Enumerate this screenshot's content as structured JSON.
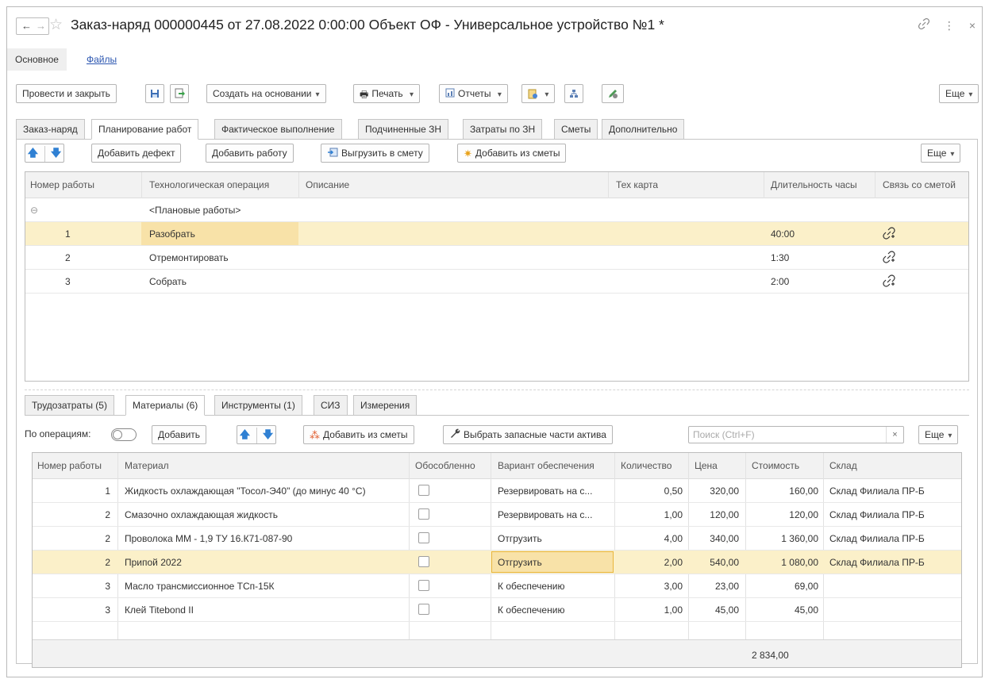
{
  "window": {
    "title": "Заказ-наряд 000000445 от 27.08.2022 0:00:00 Объект ОФ - Универсальное устройство №1 *",
    "nav_back": "←",
    "nav_forward": "→",
    "star": "☆",
    "icons": [
      "link-icon",
      "more-icon",
      "close-icon"
    ]
  },
  "section_tabs": {
    "main": "Основное",
    "files": "Файлы"
  },
  "toolbar": {
    "post_close": "Провести и закрыть",
    "create_based": "Создать на основании",
    "print": "Печать",
    "reports": "Отчеты",
    "more": "Еще"
  },
  "tabs": [
    "Заказ-наряд",
    "Планирование работ",
    "Фактическое выполнение",
    "Подчиненные ЗН",
    "Затраты по ЗН",
    "Сметы",
    "Дополнительно"
  ],
  "works_toolbar": {
    "add_defect": "Добавить дефект",
    "add_work": "Добавить работу",
    "export_estimate": "Выгрузить в смету",
    "add_from_estimate": "Добавить из сметы",
    "more": "Еще"
  },
  "works_table": {
    "columns": [
      "Номер работы",
      "Технологическая операция",
      "Описание",
      "Тех карта",
      "Длительность часы",
      "Связь со сметой"
    ],
    "group_label": "<Плановые работы>",
    "group_toggle": "⊖",
    "rows": [
      {
        "num": "1",
        "operation": "Разобрать",
        "duration": "40:00",
        "link_icon": "chain-link-icon"
      },
      {
        "num": "2",
        "operation": "Отремонтировать",
        "duration": "1:30",
        "link_icon": "chain-link-icon"
      },
      {
        "num": "3",
        "operation": "Собрать",
        "duration": "2:00",
        "link_icon": "chain-link-icon"
      }
    ],
    "selected_row": 0
  },
  "sub_tabs": [
    "Трудозатраты (5)",
    "Материалы (6)",
    "Инструменты (1)",
    "СИЗ",
    "Измерения"
  ],
  "materials_toolbar": {
    "by_operations": "По операциям:",
    "add": "Добавить",
    "add_from_estimate": "Добавить из сметы",
    "choose_parts": "Выбрать запасные части актива",
    "search_placeholder": "Поиск (Ctrl+F)",
    "clear": "×",
    "more": "Еще"
  },
  "materials_table": {
    "columns": [
      "Номер работы",
      "Материал",
      "Обособленно",
      "Вариант обеспечения",
      "Количество",
      "Цена",
      "Стоимость",
      "Склад"
    ],
    "rows": [
      {
        "num": "1",
        "material": "Жидкость охлаждающая \"Тосол-Э40\" (до минус 40 °C)",
        "variant": "Резервировать на с...",
        "qty": "0,50",
        "price": "320,00",
        "cost": "160,00",
        "warehouse": "Склад Филиала ПР-Б"
      },
      {
        "num": "2",
        "material": "Смазочно охлаждающая жидкость",
        "variant": "Резервировать на с...",
        "qty": "1,00",
        "price": "120,00",
        "cost": "120,00",
        "warehouse": "Склад Филиала ПР-Б"
      },
      {
        "num": "2",
        "material": "Проволока  ММ - 1,9 ТУ 16.К71-087-90",
        "variant": "Отгрузить",
        "qty": "4,00",
        "price": "340,00",
        "cost": "1 360,00",
        "warehouse": "Склад Филиала ПР-Б"
      },
      {
        "num": "2",
        "material": "Припой 2022",
        "variant": "Отгрузить",
        "qty": "2,00",
        "price": "540,00",
        "cost": "1 080,00",
        "warehouse": "Склад Филиала ПР-Б"
      },
      {
        "num": "3",
        "material": "Масло трансмиссионное ТСп-15К",
        "variant": "К обеспечению",
        "qty": "3,00",
        "price": "23,00",
        "cost": "69,00",
        "warehouse": ""
      },
      {
        "num": "3",
        "material": "Клей Titebond II",
        "variant": "К обеспечению",
        "qty": "1,00",
        "price": "45,00",
        "cost": "45,00",
        "warehouse": ""
      }
    ],
    "selected_row": 3,
    "total_cost": "2 834,00"
  }
}
